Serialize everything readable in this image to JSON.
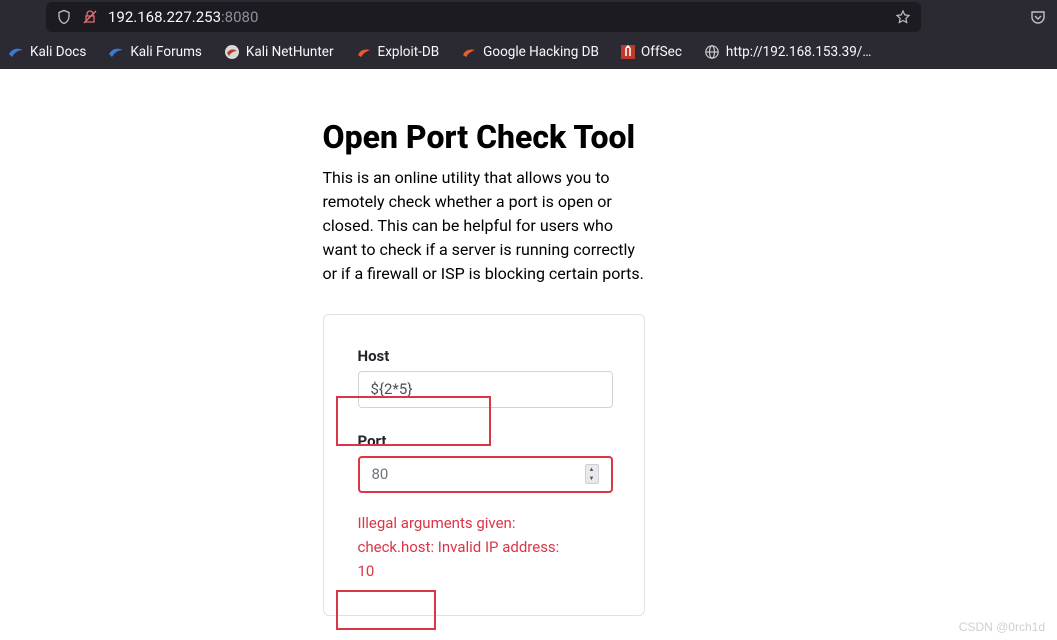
{
  "browser": {
    "url_host": "192.168.227.253",
    "url_port": ":8080",
    "bookmarks": [
      {
        "label": "Kali Docs",
        "icon": "kali"
      },
      {
        "label": "Kali Forums",
        "icon": "kali"
      },
      {
        "label": "Kali NetHunter",
        "icon": "nethunter"
      },
      {
        "label": "Exploit-DB",
        "icon": "exploit"
      },
      {
        "label": "Google Hacking DB",
        "icon": "exploit"
      },
      {
        "label": "OffSec",
        "icon": "offsec"
      },
      {
        "label": "http://192.168.153.39/…",
        "icon": "globe"
      }
    ]
  },
  "page": {
    "title": "Open Port Check Tool",
    "description": "This is an online utility that allows you to remotely check whether a port is open or closed. This can be helpful for users who want to check if a server is running correctly or if a firewall or ISP is blocking certain ports.",
    "form": {
      "host_label": "Host",
      "host_value": "${2*5}",
      "port_label": "Port",
      "port_value": "80",
      "error_line1": "Illegal arguments given:",
      "error_line2": "check.host: Invalid IP address:",
      "error_line3": "10"
    }
  },
  "watermark": "CSDN @0rch1d"
}
